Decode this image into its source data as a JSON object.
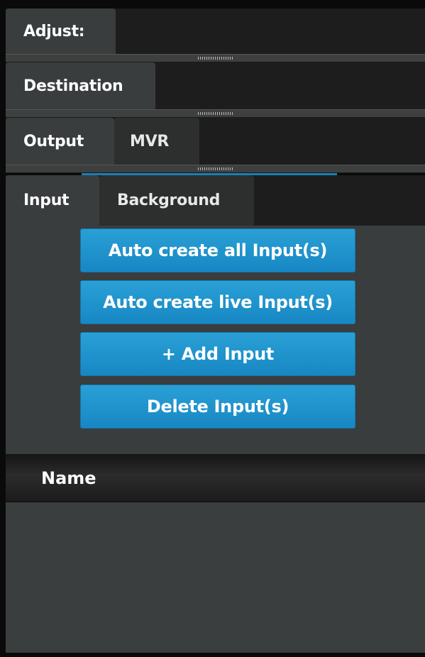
{
  "panels": {
    "adjust": {
      "tabs": [
        {
          "label": "Adjust:",
          "active": true
        }
      ]
    },
    "destination": {
      "tabs": [
        {
          "label": "Destination",
          "active": true
        }
      ]
    },
    "output": {
      "tabs": [
        {
          "label": "Output",
          "active": true
        },
        {
          "label": "MVR",
          "active": false
        }
      ]
    },
    "input": {
      "tabs": [
        {
          "label": "Input",
          "active": true
        },
        {
          "label": "Background",
          "active": false
        }
      ]
    }
  },
  "actions": {
    "auto_create_all": "Auto create all Input(s)",
    "auto_create_live": "Auto create live Input(s)",
    "add_input": "+ Add Input",
    "delete_inputs": "Delete Input(s)"
  },
  "table": {
    "columns": [
      "Name"
    ],
    "rows": []
  },
  "colors": {
    "accent": "#1a8ccb",
    "panel_bg": "#3a3d3d",
    "tab_bar_bg": "#1d1d1d"
  }
}
